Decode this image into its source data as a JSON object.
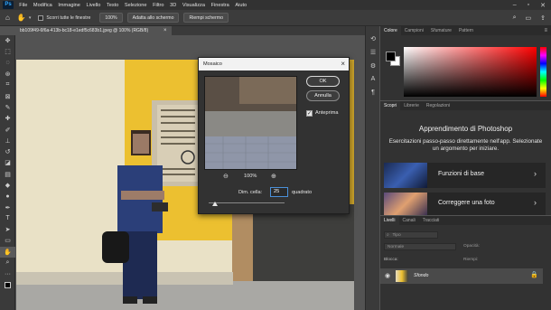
{
  "menu": {
    "logo": "Ps",
    "items": [
      "File",
      "Modifica",
      "Immagine",
      "Livello",
      "Testo",
      "Selezione",
      "Filtro",
      "3D",
      "Visualizza",
      "Finestra",
      "Aiuto"
    ]
  },
  "options": {
    "scroll_all_label": "Scorri tutte le finestre",
    "zoom_value": "100%",
    "fit_screen_label": "Adatta allo schermo",
    "fill_screen_label": "Riempi schermo"
  },
  "document": {
    "tab_title": "bb109f49-6f6a-413b-bc18-e1edf5c683b1.jpeg @ 100% (RGB/8)",
    "close_glyph": "×"
  },
  "mosaic_dialog": {
    "title": "Mosaico",
    "close_glyph": "×",
    "ok_label": "OK",
    "cancel_label": "Annulla",
    "preview_label": "Anteprima",
    "preview_checked": true,
    "zoom_value": "100%",
    "cell_size_label": "Dim. cella:",
    "cell_size_value": "25",
    "unit_label": "quadrato"
  },
  "color_panel": {
    "tabs": [
      "Colore",
      "Campioni",
      "Sfumature",
      "Pattern"
    ],
    "foreground": "#000000",
    "background": "#ffffff"
  },
  "learn_panel": {
    "tabs": [
      "Scopri",
      "Librerie",
      "Regolazioni"
    ],
    "title": "Apprendimento di Photoshop",
    "subtitle": "Esercitazioni passo-passo direttamente nell'app. Selezionate un argomento per iniziare.",
    "cards": [
      {
        "label": "Funzioni di base"
      },
      {
        "label": "Correggere una foto"
      }
    ]
  },
  "layers_panel": {
    "tabs": [
      "Livelli",
      "Canali",
      "Tracciati"
    ],
    "kind_label": "Tipo",
    "blend_mode": "Normale",
    "opacity_label": "Opacità:",
    "lock_label": "Blocca:",
    "fill_label": "Riempi:",
    "layer_name": "Sfondo"
  },
  "icons": {
    "move": "move-icon",
    "hand": "hand-icon",
    "zoom_out": "zoom-out-icon",
    "zoom_in": "zoom-in-icon",
    "eye": "eye-icon",
    "lock": "lock-icon"
  }
}
